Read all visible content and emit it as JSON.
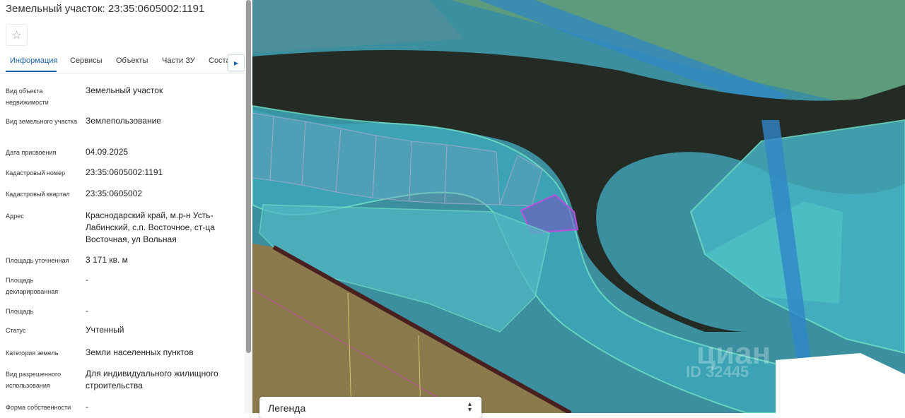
{
  "panel": {
    "title": "Земельный участок: 23:35:0605002:1191",
    "tabs": [
      {
        "label": "Информация",
        "active": true
      },
      {
        "label": "Сервисы"
      },
      {
        "label": "Объекты"
      },
      {
        "label": "Части ЗУ"
      },
      {
        "label": "Соста"
      }
    ],
    "fields": [
      {
        "label": "Вид объекта недвижимости",
        "value": "Земельный участок"
      },
      {
        "label": "Вид земельного участка",
        "value": "Землепользование"
      },
      {
        "label": "Дата присвоения",
        "value": "04.09.2025"
      },
      {
        "label": "Кадастровый номер",
        "value": "23:35:0605002:1191"
      },
      {
        "label": "Кадастровый квартал",
        "value": "23:35:0605002"
      },
      {
        "label": "Адрес",
        "value": "Краснодарский край, м.р-н Усть-Лабинский, с.п. Восточное, ст-ца Восточная, ул Вольная"
      },
      {
        "label": "Площадь уточненная",
        "value": "3 171 кв. м"
      },
      {
        "label": "Площадь декларированная",
        "value": "-"
      },
      {
        "label": "Площадь",
        "value": "-"
      },
      {
        "label": "Статус",
        "value": "Учтенный"
      },
      {
        "label": "Категория земель",
        "value": "Земли населенных пунктов"
      },
      {
        "label": "Вид разрешенного использования",
        "value": "Для индивидуального жилищного строительства"
      },
      {
        "label": "Форма собственности",
        "value": "-"
      }
    ]
  },
  "map": {
    "legend_label": "Легенда",
    "watermark_brand": "циан",
    "watermark_id": "ID 32445",
    "colors": {
      "water": "#242a24",
      "zone": "#3fa6b4",
      "zone_edge": "#6fe0c8",
      "parcel_highlight": "#7a4fc0",
      "field": "#8a7a4c"
    }
  },
  "icons": {
    "favorite": "star-icon",
    "tab_next": "chevron-right-icon",
    "legend_toggle": "chevron-up-down-icon"
  }
}
